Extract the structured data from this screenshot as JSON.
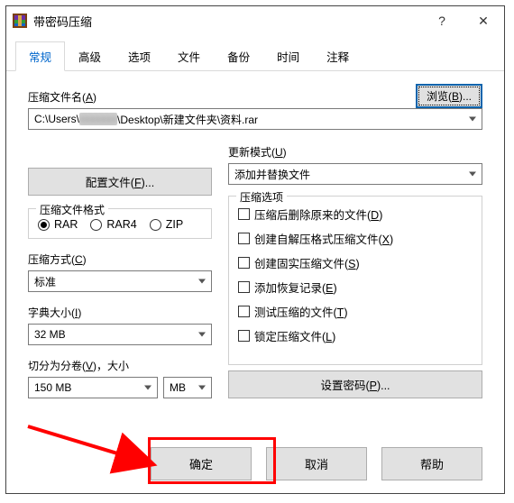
{
  "window": {
    "title": "带密码压缩",
    "help": "?",
    "close": "✕"
  },
  "tabs": [
    {
      "label": "常规",
      "active": true
    },
    {
      "label": "高级"
    },
    {
      "label": "选项"
    },
    {
      "label": "文件"
    },
    {
      "label": "备份"
    },
    {
      "label": "时间"
    },
    {
      "label": "注释"
    }
  ],
  "archive_name": {
    "label_pre": "压缩文件名(",
    "label_u": "A",
    "label_post": ")",
    "value_pre": "C:\\Users\\",
    "value_blur": "xxxxxxx",
    "value_post": "\\Desktop\\新建文件夹\\资料.rar"
  },
  "browse": {
    "pre": "浏览(",
    "u": "B",
    "post": ")..."
  },
  "update_mode": {
    "label_pre": "更新模式(",
    "label_u": "U",
    "label_post": ")",
    "value": "添加并替换文件"
  },
  "profiles": {
    "pre": "配置文件(",
    "u": "F",
    "post": ")..."
  },
  "format_group": {
    "legend": "压缩文件格式",
    "options": [
      {
        "label": "RAR",
        "selected": true
      },
      {
        "label": "RAR4",
        "selected": false
      },
      {
        "label": "ZIP",
        "selected": false
      }
    ]
  },
  "compression": {
    "label_pre": "压缩方式(",
    "label_u": "C",
    "label_post": ")",
    "value": "标准"
  },
  "dictionary": {
    "label_pre": "字典大小(",
    "label_u": "I",
    "label_post": ")",
    "value": "32 MB"
  },
  "split": {
    "label_pre": "切分为分卷(",
    "label_u": "V",
    "label_post": ")，大小",
    "size": "150 MB",
    "unit": "MB"
  },
  "options_group": {
    "legend": "压缩选项",
    "items": [
      {
        "pre": "压缩后删除原来的文件(",
        "u": "D",
        "post": ")"
      },
      {
        "pre": "创建自解压格式压缩文件(",
        "u": "X",
        "post": ")"
      },
      {
        "pre": "创建固实压缩文件(",
        "u": "S",
        "post": ")"
      },
      {
        "pre": "添加恢复记录(",
        "u": "E",
        "post": ")"
      },
      {
        "pre": "测试压缩的文件(",
        "u": "T",
        "post": ")"
      },
      {
        "pre": "锁定压缩文件(",
        "u": "L",
        "post": ")"
      }
    ]
  },
  "set_password": {
    "pre": "设置密码(",
    "u": "P",
    "post": ")..."
  },
  "footer": {
    "ok": "确定",
    "cancel": "取消",
    "help": "帮助"
  }
}
